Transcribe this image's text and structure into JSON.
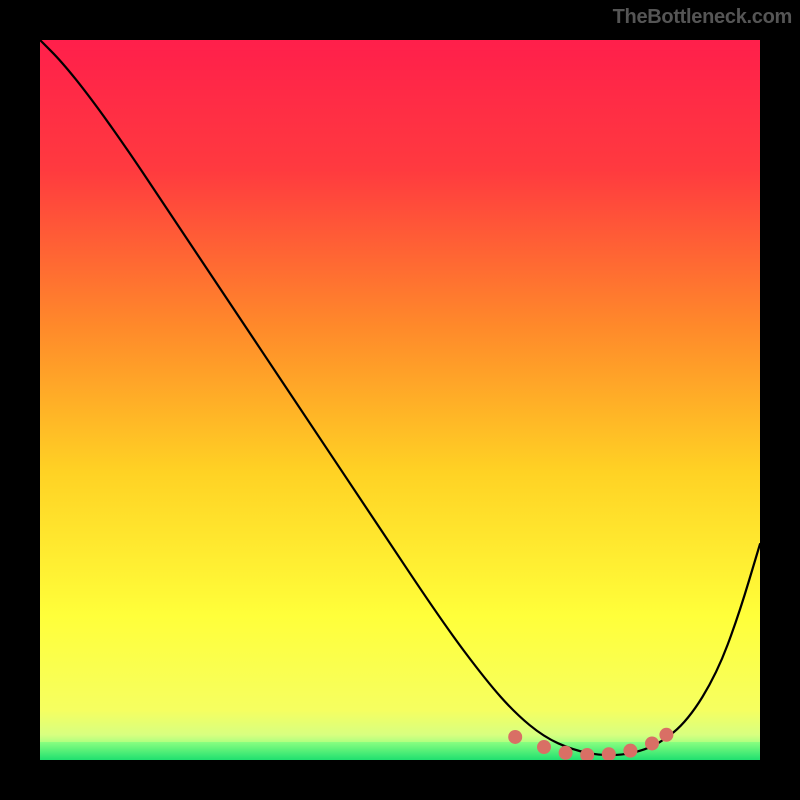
{
  "attribution": "TheBottleneck.com",
  "chart_data": {
    "type": "line",
    "title": "",
    "xlabel": "",
    "ylabel": "",
    "xlim": [
      0,
      100
    ],
    "ylim": [
      0,
      100
    ],
    "gradient_stops": [
      {
        "offset": 0.0,
        "color": "#ff1f4b"
      },
      {
        "offset": 0.18,
        "color": "#ff3a3f"
      },
      {
        "offset": 0.4,
        "color": "#ff8a2a"
      },
      {
        "offset": 0.6,
        "color": "#ffd224"
      },
      {
        "offset": 0.8,
        "color": "#ffff3a"
      },
      {
        "offset": 0.93,
        "color": "#f6ff60"
      },
      {
        "offset": 0.965,
        "color": "#d8ff80"
      },
      {
        "offset": 0.985,
        "color": "#8aff80"
      },
      {
        "offset": 1.0,
        "color": "#20e070"
      }
    ],
    "green_band": {
      "from_y": 0,
      "to_y": 2.5,
      "color_top": "#8aff80",
      "color_bottom": "#20e070"
    },
    "series": [
      {
        "name": "bottleneck-curve",
        "color": "#000000",
        "width": 2.2,
        "x": [
          0,
          3,
          7,
          12,
          18,
          26,
          36,
          46,
          56,
          62,
          66,
          70,
          74,
          78,
          82,
          86,
          90,
          94,
          97,
          100
        ],
        "y": [
          100,
          97,
          92,
          85,
          76,
          64,
          49,
          34,
          19,
          11,
          6.5,
          3.2,
          1.4,
          0.6,
          0.8,
          2.2,
          5.5,
          12,
          20,
          30
        ]
      }
    ],
    "markers": {
      "name": "bottom-dots",
      "color": "#d96f65",
      "radius": 7,
      "points": [
        {
          "x": 66,
          "y": 3.2
        },
        {
          "x": 70,
          "y": 1.8
        },
        {
          "x": 73,
          "y": 1.0
        },
        {
          "x": 76,
          "y": 0.7
        },
        {
          "x": 79,
          "y": 0.8
        },
        {
          "x": 82,
          "y": 1.3
        },
        {
          "x": 85,
          "y": 2.3
        },
        {
          "x": 87,
          "y": 3.5
        }
      ]
    }
  }
}
